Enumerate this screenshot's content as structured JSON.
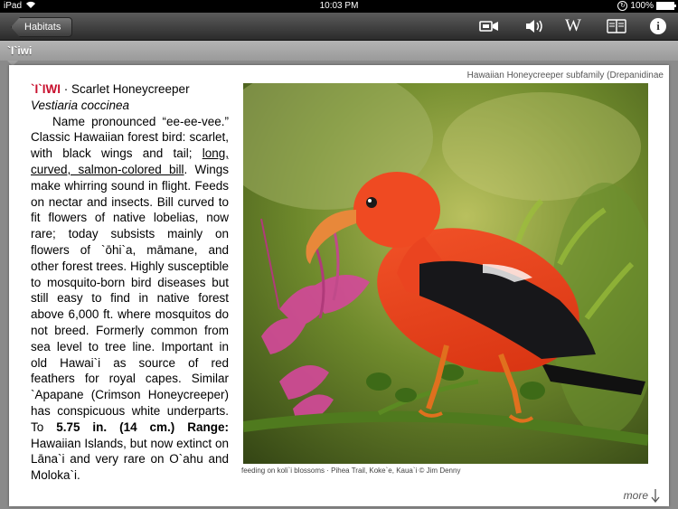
{
  "status": {
    "device": "iPad",
    "time": "10:03 PM",
    "battery": "100%"
  },
  "toolbar": {
    "back_label": "Habitats",
    "icons": [
      "video-icon",
      "speaker-icon",
      "wikipedia-icon",
      "book-icon",
      "info-icon"
    ],
    "wiki_glyph": "W",
    "info_glyph": "i"
  },
  "title": "`I`iwi",
  "species": {
    "name": "`I`IWI",
    "sep": " · ",
    "common": "Scarlet Honeycreeper",
    "scientific": "Vestiaria coccinea",
    "desc_1": "Name pronounced “ee-ee-vee.” Classic Hawaiian forest bird: scarlet, with black wings and tail; ",
    "desc_underline": "long, curved, salmon-colored bill",
    "desc_2": ". Wings make whirring sound in flight. Feeds on nectar and insects. Bill curved to fit flowers of native lobelias, now rare; today subsists mainly on flowers of `ōhi`a, māmane, and other forest trees. Highly susceptible to mosquito-born bird diseases but still easy to find in native forest above 6,000 ft. where mosquitos do not breed. Formerly common from sea level to tree line. Important in old Hawai`i as source of red feathers for royal capes. Similar `Apapane (Crimson Honeycreeper) has conspicuous white underparts. To ",
    "size": "5.75 in. (14 cm.)",
    "range_label": "Range:",
    "range": " Hawaiian Islands, but now extinct on Lāna`i and very rare on O`ahu and Moloka`i."
  },
  "subfamily": "Hawaiian Honeycreeper subfamily (Drepanidinae",
  "caption": "feeding on koli`i blossoms · Pihea Trail, Koke`e, Kaua`i © Jim Denny",
  "more_label": "more",
  "colors": {
    "accent": "#c8102e",
    "bird": "#e8401a"
  }
}
